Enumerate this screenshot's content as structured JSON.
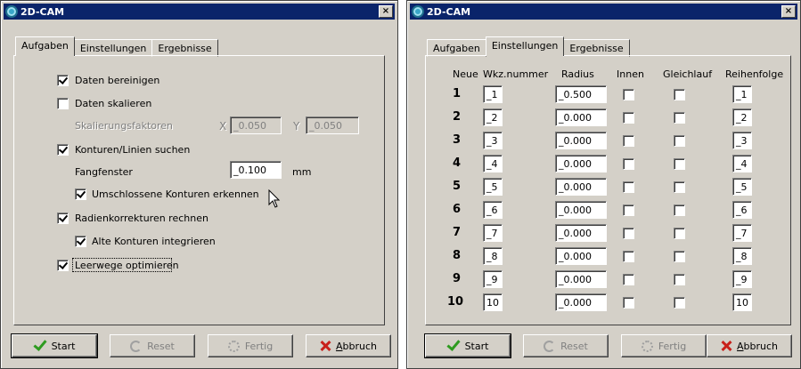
{
  "win1": {
    "title": "2D-CAM",
    "close": "×",
    "tabs": [
      "Aufgaben",
      "Einstellungen",
      "Ergebnisse"
    ],
    "options": {
      "daten_bereinigen": {
        "label": "Daten bereinigen",
        "checked": true
      },
      "daten_skalieren": {
        "label": "Daten skalieren",
        "checked": false
      },
      "skalierungsfaktoren": "Skalierungsfaktoren",
      "x_label": "X",
      "x_value": "_0.050",
      "y_label": "Y",
      "y_value": "_0.050",
      "konturen_suchen": {
        "label": "Konturen/Linien suchen",
        "checked": true
      },
      "fangfenster": "Fangfenster",
      "fangfenster_value": "_0.100",
      "fangfenster_unit": "mm",
      "umschlossene": {
        "label": "Umschlossene Konturen erkennen",
        "checked": true
      },
      "radienkorrekturen": {
        "label": "Radienkorrekturen rechnen",
        "checked": true
      },
      "alte_konturen": {
        "label": "Alte Konturen integrieren",
        "checked": true
      },
      "leerwege": {
        "label": "Leerwege optimieren",
        "checked": true
      }
    },
    "buttons": {
      "start": "Start",
      "reset": "Reset",
      "fertig": "Fertig",
      "abbruch_first": "A",
      "abbruch_rest": "bbruch"
    }
  },
  "win2": {
    "title": "2D-CAM",
    "close": "×",
    "tabs": [
      "Aufgaben",
      "Einstellungen",
      "Ergebnisse"
    ],
    "headers": {
      "neue": "Neue",
      "wkz": "Wkz.nummer",
      "radius": "Radius",
      "innen": "Innen",
      "gleichlauf": "Gleichlauf",
      "reihenfolge": "Reihenfolge"
    },
    "rows": [
      {
        "num": "1",
        "wkz": "_1",
        "radius": "_0.500",
        "innen": false,
        "gleichlauf": false,
        "reihenfolge": "_1"
      },
      {
        "num": "2",
        "wkz": "_2",
        "radius": "_0.000",
        "innen": false,
        "gleichlauf": false,
        "reihenfolge": "_2"
      },
      {
        "num": "3",
        "wkz": "_3",
        "radius": "_0.000",
        "innen": false,
        "gleichlauf": false,
        "reihenfolge": "_3"
      },
      {
        "num": "4",
        "wkz": "_4",
        "radius": "_0.000",
        "innen": false,
        "gleichlauf": false,
        "reihenfolge": "_4"
      },
      {
        "num": "5",
        "wkz": "_5",
        "radius": "_0.000",
        "innen": false,
        "gleichlauf": false,
        "reihenfolge": "_5"
      },
      {
        "num": "6",
        "wkz": "_6",
        "radius": "_0.000",
        "innen": false,
        "gleichlauf": false,
        "reihenfolge": "_6"
      },
      {
        "num": "7",
        "wkz": "_7",
        "radius": "_0.000",
        "innen": false,
        "gleichlauf": false,
        "reihenfolge": "_7"
      },
      {
        "num": "8",
        "wkz": "_8",
        "radius": "_0.000",
        "innen": false,
        "gleichlauf": false,
        "reihenfolge": "_8"
      },
      {
        "num": "9",
        "wkz": "_9",
        "radius": "_0.000",
        "innen": false,
        "gleichlauf": false,
        "reihenfolge": "_9"
      },
      {
        "num": "10",
        "wkz": "10",
        "radius": "_0.000",
        "innen": false,
        "gleichlauf": false,
        "reihenfolge": "10"
      }
    ],
    "buttons": {
      "start": "Start",
      "reset": "Reset",
      "fertig": "Fertig",
      "abbruch_first": "A",
      "abbruch_rest": "bbruch"
    }
  }
}
